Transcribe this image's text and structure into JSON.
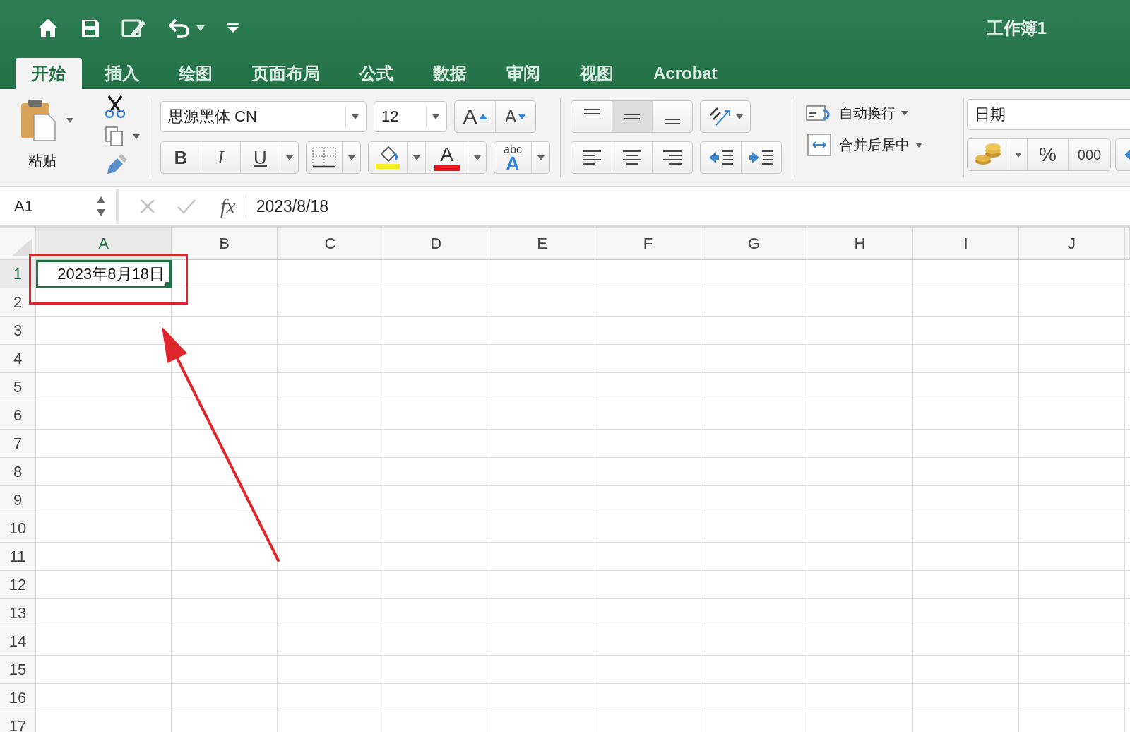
{
  "window": {
    "title": "工作簿1"
  },
  "tabs": [
    {
      "label": "开始",
      "selected": true
    },
    {
      "label": "插入",
      "selected": false
    },
    {
      "label": "绘图",
      "selected": false
    },
    {
      "label": "页面布局",
      "selected": false
    },
    {
      "label": "公式",
      "selected": false
    },
    {
      "label": "数据",
      "selected": false
    },
    {
      "label": "审阅",
      "selected": false
    },
    {
      "label": "视图",
      "selected": false
    },
    {
      "label": "Acrobat",
      "selected": false
    }
  ],
  "ribbon": {
    "paste_label": "粘贴",
    "font_name": "思源黑体 CN",
    "font_size": "12",
    "grow_font": "A",
    "shrink_font": "A",
    "bold": "B",
    "italic": "I",
    "underline": "U",
    "font_color": "A",
    "phonetic_top": "abc",
    "phonetic_bottom": "A",
    "vertical_align": [
      {
        "kind": "top",
        "selected": false
      },
      {
        "kind": "middle",
        "selected": true
      },
      {
        "kind": "bottom",
        "selected": false
      }
    ],
    "wrap_text": "自动换行",
    "merge_center": "合并后居中",
    "number_format": "日期",
    "percent": "%",
    "thousands": "000"
  },
  "formula_bar": {
    "name_box": "A1",
    "fx": "fx",
    "value": "2023/8/18"
  },
  "sheet": {
    "columns": [
      {
        "label": "A",
        "selected": true
      },
      {
        "label": "B",
        "selected": false
      },
      {
        "label": "C",
        "selected": false
      },
      {
        "label": "D",
        "selected": false
      },
      {
        "label": "E",
        "selected": false
      },
      {
        "label": "F",
        "selected": false
      },
      {
        "label": "G",
        "selected": false
      },
      {
        "label": "H",
        "selected": false
      },
      {
        "label": "I",
        "selected": false
      },
      {
        "label": "J",
        "selected": false
      }
    ],
    "rows": [
      {
        "label": "1",
        "selected": true,
        "cells": [
          {
            "value": "2023年8月18日",
            "selected": true
          }
        ]
      },
      {
        "label": "2",
        "selected": false
      },
      {
        "label": "3",
        "selected": false
      },
      {
        "label": "4",
        "selected": false
      },
      {
        "label": "5",
        "selected": false
      },
      {
        "label": "6",
        "selected": false
      },
      {
        "label": "7",
        "selected": false
      },
      {
        "label": "8",
        "selected": false
      },
      {
        "label": "9",
        "selected": false
      },
      {
        "label": "10",
        "selected": false
      },
      {
        "label": "11",
        "selected": false
      },
      {
        "label": "12",
        "selected": false
      },
      {
        "label": "13",
        "selected": false
      },
      {
        "label": "14",
        "selected": false
      },
      {
        "label": "15",
        "selected": false
      },
      {
        "label": "16",
        "selected": false
      },
      {
        "label": "17",
        "selected": false
      }
    ]
  }
}
